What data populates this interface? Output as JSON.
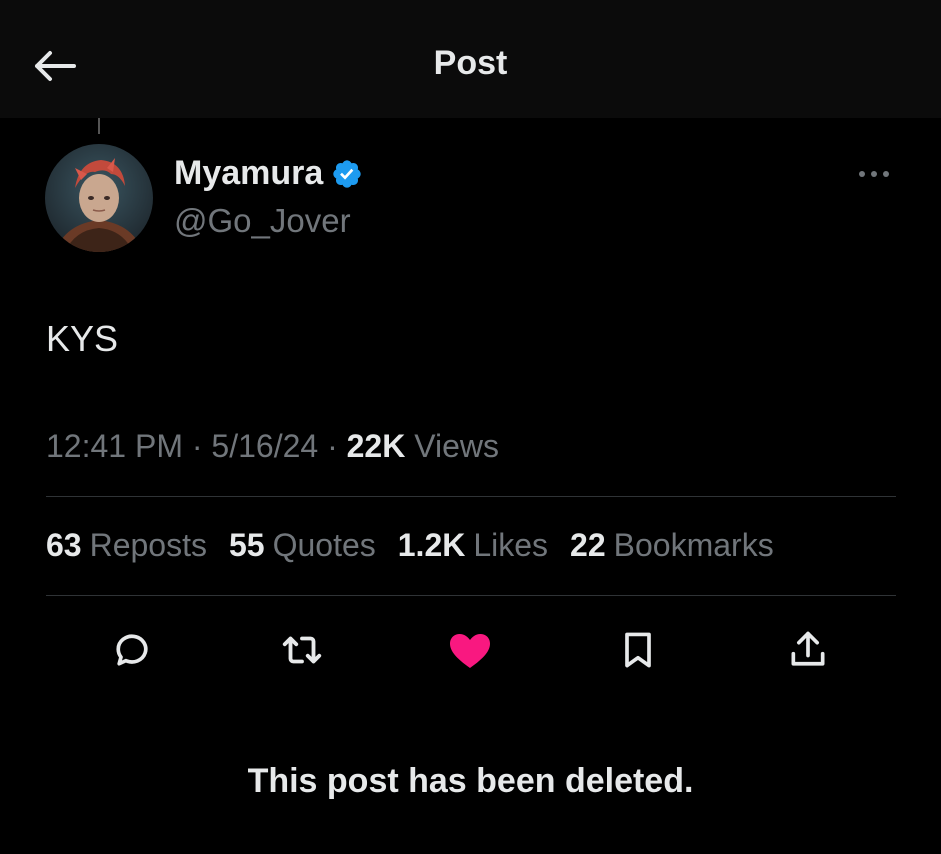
{
  "header": {
    "title": "Post",
    "back_icon": "arrow-left-icon"
  },
  "author": {
    "display_name": "Myamura",
    "handle": "@Go_Jover",
    "verified": true,
    "verified_color": "#1d9bf0"
  },
  "post": {
    "text": "KYS",
    "time": "12:41 PM",
    "date": "5/16/24",
    "views_count": "22K",
    "views_label": "Views",
    "separator": " · "
  },
  "stats": [
    {
      "count": "63",
      "label": "Reposts"
    },
    {
      "count": "55",
      "label": "Quotes"
    },
    {
      "count": "1.2K",
      "label": "Likes"
    },
    {
      "count": "22",
      "label": "Bookmarks"
    }
  ],
  "actions": [
    {
      "icon": "reply-icon"
    },
    {
      "icon": "repost-icon"
    },
    {
      "icon": "like-icon",
      "active": true,
      "color": "#f91880"
    },
    {
      "icon": "bookmark-icon"
    },
    {
      "icon": "share-icon"
    }
  ],
  "notice": "This post has been deleted.",
  "colors": {
    "background": "#000000",
    "header_bg": "#0b0b0b",
    "text_primary": "#e7e9ea",
    "text_secondary": "#71767b",
    "divider": "#2f3336"
  }
}
